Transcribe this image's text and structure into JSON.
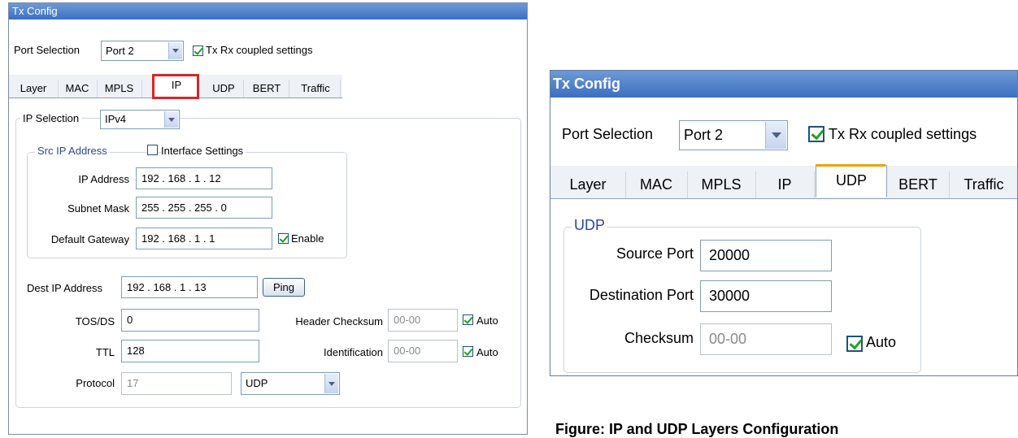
{
  "left_panel": {
    "title": "Tx Config",
    "port_label": "Port Selection",
    "port_value": "Port 2",
    "coupled_label": "Tx Rx coupled settings",
    "tabs": [
      "Layer",
      "MAC",
      "MPLS",
      "IP",
      "UDP",
      "BERT",
      "Traffic"
    ],
    "active_tab": "IP",
    "ip_selection_label": "IP Selection",
    "ip_selection_value": "IPv4",
    "src_group_title": "Src IP Address",
    "interface_settings_label": "Interface Settings",
    "ip_address_label": "IP Address",
    "ip_address_value": "192 . 168 .   1  .  12",
    "subnet_label": "Subnet Mask",
    "subnet_value": "255 . 255 . 255 .  0",
    "gateway_label": "Default Gateway",
    "gateway_value": "192 . 168 .   1  .  1",
    "enable_label": "Enable",
    "dest_label": "Dest IP Address",
    "dest_value": "192 . 168 .   1  .  13",
    "ping_label": "Ping",
    "tos_label": "TOS/DS",
    "tos_value": "0",
    "header_checksum_label": "Header Checksum",
    "header_checksum_value": "00-00",
    "auto_label_1": "Auto",
    "ttl_label": "TTL",
    "ttl_value": "128",
    "identification_label": "Identification",
    "identification_value": "00-00",
    "auto_label_2": "Auto",
    "protocol_label": "Protocol",
    "protocol_value": "17",
    "protocol_select": "UDP"
  },
  "right_panel": {
    "title": "Tx Config",
    "port_label": "Port Selection",
    "port_value": "Port 2",
    "coupled_label": "Tx Rx coupled settings",
    "tabs": [
      "Layer",
      "MAC",
      "MPLS",
      "IP",
      "UDP",
      "BERT",
      "Traffic"
    ],
    "active_tab": "UDP",
    "udp_group_title": "UDP",
    "source_port_label": "Source Port",
    "source_port_value": "20000",
    "dest_port_label": "Destination Port",
    "dest_port_value": "30000",
    "checksum_label": "Checksum",
    "checksum_value": "00-00",
    "auto_label": "Auto"
  },
  "caption": "Figure: IP and UDP Layers Configuration",
  "colors": {
    "title_bar": "#3d6fc0",
    "highlight": "#d9252a",
    "group_title": "#28489e"
  }
}
